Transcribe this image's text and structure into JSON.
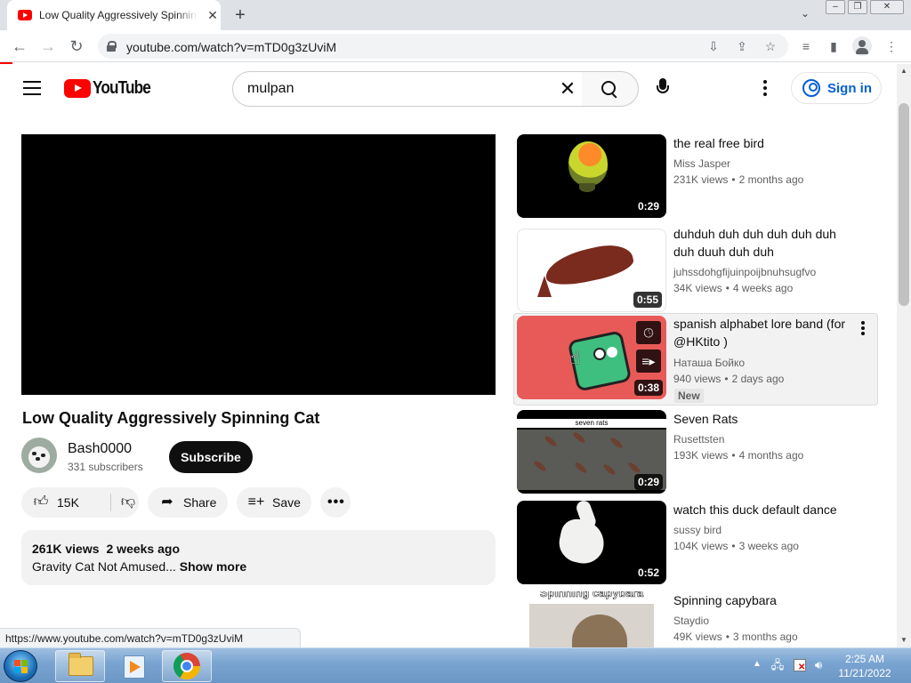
{
  "browser": {
    "tab_title": "Low Quality Aggressively Spinning Cat",
    "tab_close": "✕",
    "new_tab": "+",
    "url": "youtube.com/watch?v=mTD0g3zUviM",
    "status_url": "https://www.youtube.com/watch?v=mTD0g3zUviM",
    "icons": {
      "back": "←",
      "forward": "→",
      "reload": "↻",
      "install": "⇩",
      "share": "⇪",
      "bookmark": "☆",
      "reading_list": "≡",
      "side_panel": "▮",
      "menu": "⋮",
      "tab_search": "⌄"
    }
  },
  "youtube": {
    "logo_text": "YouTube",
    "search": {
      "value": "mulpan",
      "clear": "✕"
    },
    "signin_label": "Sign in",
    "video": {
      "title": "Low Quality Aggressively Spinning Cat",
      "channel": "Bash0000",
      "subscribers": "331 subscribers",
      "subscribe_label": "Subscribe",
      "likes": "15K",
      "share_label": "Share",
      "save_label": "Save",
      "more_label": "•••",
      "views": "261K views",
      "age": "2 weeks ago",
      "description": "Gravity Cat Not Amused...",
      "show_more": "Show more"
    },
    "recommendations": [
      {
        "title": "the real free bird",
        "channel": "Miss Jasper",
        "views": "231K views",
        "age": "2 months ago",
        "duration": "0:29"
      },
      {
        "title": "duhduh duh duh duh duh duh duh duuh duh duh",
        "channel": "juhssdohgfijuinpoijbnuhsugfvo",
        "views": "34K views",
        "age": "4 weeks ago",
        "duration": "0:55"
      },
      {
        "title": "spanish alphabet lore band (for @HKtito )",
        "channel": "Наташа Бойко",
        "views": "940 views",
        "age": "2 days ago",
        "duration": "0:38",
        "badge": "New"
      },
      {
        "title": "Seven Rats",
        "channel": "Rusettsten",
        "views": "193K views",
        "age": "4 months ago",
        "duration": "0:29",
        "thumb_label": "seven rats"
      },
      {
        "title": "watch this duck default dance",
        "channel": "sussy bird",
        "views": "104K views",
        "age": "3 weeks ago",
        "duration": "0:52"
      },
      {
        "title": "Spinning capybara",
        "channel": "Staydio",
        "views": "49K views",
        "age": "3 months ago",
        "thumb_label": "Spinning capybara"
      }
    ],
    "meta_separator": "•"
  },
  "taskbar": {
    "clock_time": "2:25 AM",
    "clock_date": "11/21/2022"
  },
  "colors": {
    "youtube_red": "#ff0000",
    "link_blue": "#065fd4"
  }
}
